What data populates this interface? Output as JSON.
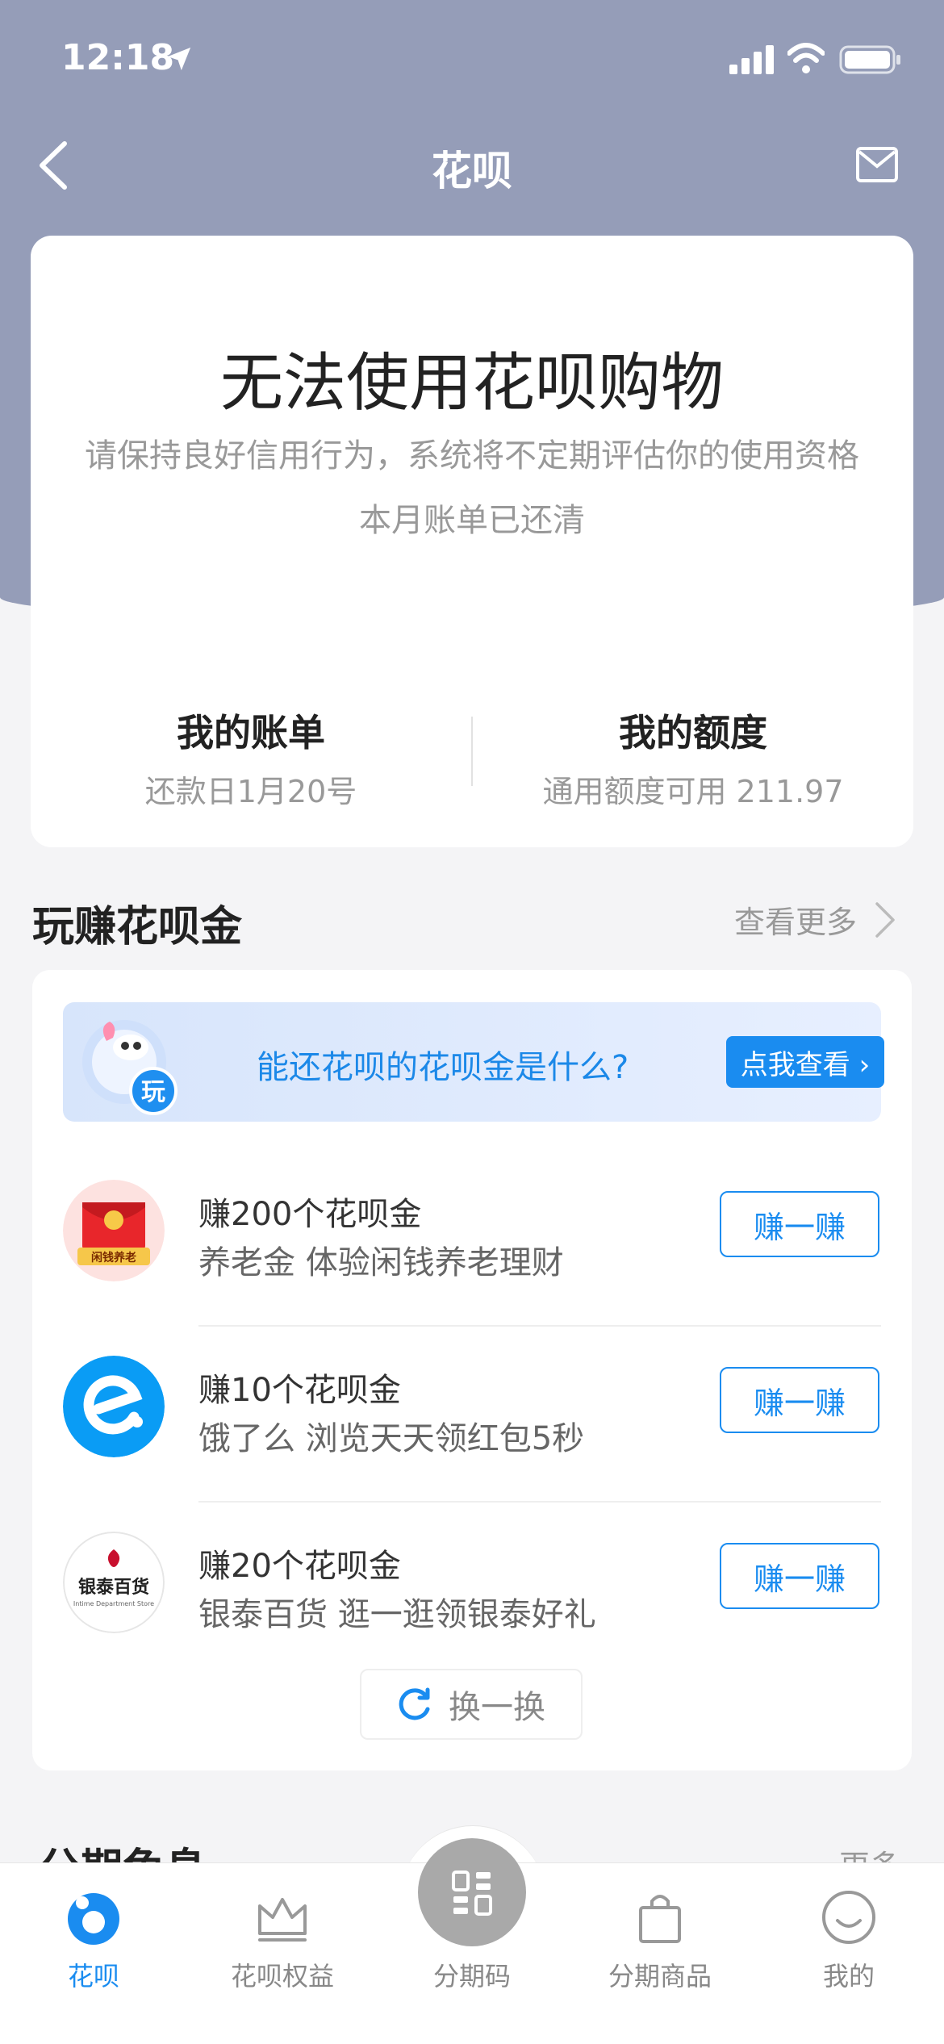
{
  "status_bar": {
    "time": "12:18"
  },
  "nav": {
    "title": "花呗"
  },
  "main_card": {
    "title": "无法使用花呗购物",
    "subtitle": "请保持良好信用行为，系统将不定期评估你的使用资格",
    "status": "本月账单已还清",
    "bill": {
      "title": "我的账单",
      "sub": "还款日1月20号"
    },
    "quota": {
      "title": "我的额度",
      "sub": "通用额度可用 211.97"
    }
  },
  "earn_section": {
    "title": "玩赚花呗金",
    "more": "查看更多",
    "promo": {
      "badge": "玩",
      "text": "能还花呗的花呗金是什么?",
      "button": "点我查看 ›"
    },
    "tasks": [
      {
        "title": "赚200个花呗金",
        "desc": "养老金 体验闲钱养老理财",
        "button": "赚一赚",
        "logo_text": "闲钱养老",
        "logo_icon": "red-envelope-icon"
      },
      {
        "title": "赚10个花呗金",
        "desc": "饿了么 浏览天天领红包5秒",
        "button": "赚一赚",
        "logo_icon": "eleme-logo"
      },
      {
        "title": "赚20个花呗金",
        "desc": "银泰百货 逛一逛领银泰好礼",
        "button": "赚一赚",
        "logo_text": "银泰百货",
        "logo_sub": "Intime Department Store",
        "logo_icon": "intime-logo"
      }
    ],
    "swap": "换一换"
  },
  "next_section": {
    "title": "分期免息",
    "more": "更多"
  },
  "tabbar": {
    "tabs": [
      {
        "label": "花呗",
        "icon": "huabei-icon"
      },
      {
        "label": "花呗权益",
        "icon": "crown-icon"
      },
      {
        "label": "分期码",
        "icon": "qr-code-icon"
      },
      {
        "label": "分期商品",
        "icon": "shopping-bag-icon"
      },
      {
        "label": "我的",
        "icon": "smile-icon"
      }
    ]
  },
  "colors": {
    "header": "#959db8",
    "accent": "#1a8cf0",
    "background": "#f4f4f6"
  }
}
